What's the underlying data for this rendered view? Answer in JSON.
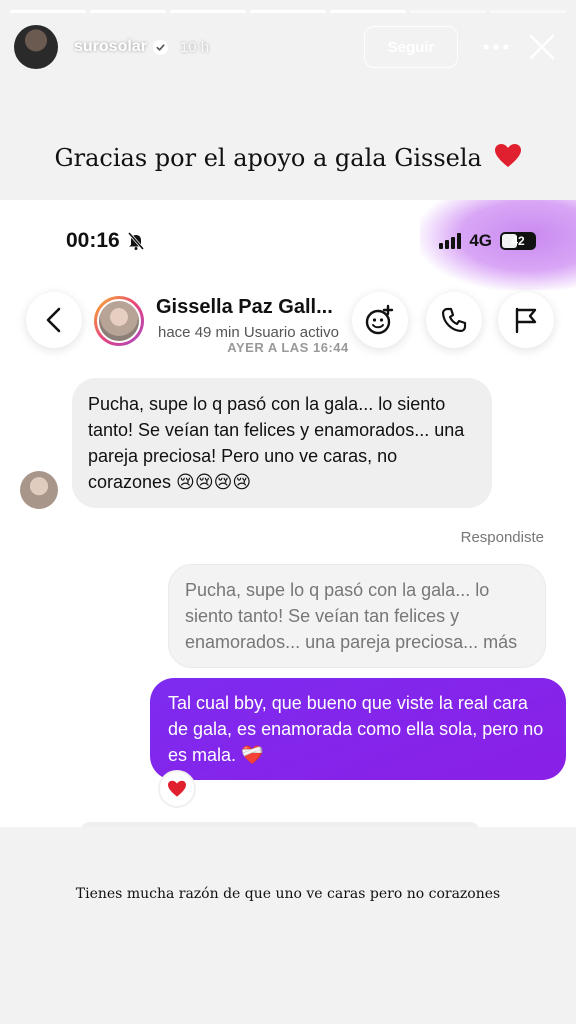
{
  "story": {
    "username": "surosolar",
    "time": "10 h",
    "follow_label": "Seguir",
    "segments": 7,
    "caption_top": "Gracias por el apoyo a gala Gissela",
    "caption_bottom": "Tienes mucha razón de que uno ve caras pero no corazones"
  },
  "phone": {
    "clock": "00:16",
    "network": "4G",
    "battery": "42"
  },
  "chat": {
    "contact_name": "Gissella Paz Gall...",
    "contact_status": "hace 49 min    Usuario activo",
    "date_label": "AYER A LAS 16:44",
    "messages": [
      {
        "text": "Pucha, supe lo q pasó con la gala... lo siento tanto! Se veían tan felices y enamorados... una pareja preciosa! Pero uno ve caras, no corazones 😢😢😢😢"
      },
      {
        "replied_label": "Respondiste"
      },
      {
        "text": "Pucha, supe lo q pasó con la gala... lo siento tanto! Se veían tan felices y enamorados... una pareja preciosa... más"
      },
      {
        "text": "Tal cual bby, que bueno que viste la real cara de gala, es enamorada como ella sola, pero no es mala. ❤️‍🩹"
      }
    ]
  },
  "colors": {
    "outgoing_bubble": "#8229f2",
    "incoming_bubble": "#efefef",
    "heart": "#e0202e"
  }
}
